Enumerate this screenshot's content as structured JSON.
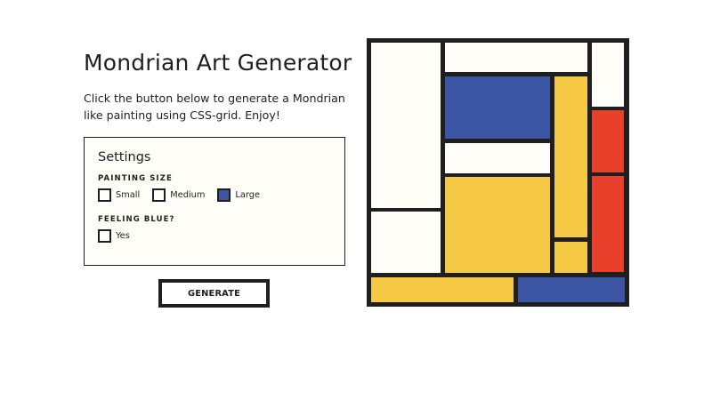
{
  "header": {
    "title": "Mondrian Art Generator",
    "description": "Click the button below to generate a Mondrian like painting using CSS-grid. Enjoy!"
  },
  "settings": {
    "title": "Settings",
    "painting_size": {
      "label": "PAINTING SIZE",
      "options": [
        {
          "label": "Small",
          "checked": false
        },
        {
          "label": "Medium",
          "checked": false
        },
        {
          "label": "Large",
          "checked": true
        }
      ]
    },
    "feeling_blue": {
      "label": "FEELING BLUE?",
      "options": [
        {
          "label": "Yes",
          "checked": false
        }
      ]
    }
  },
  "generate_button": {
    "label": "GENERATE"
  },
  "colors": {
    "white": "#fffdf8",
    "blue": "#3b55a3",
    "yellow": "#f6c944",
    "red": "#e8402a",
    "border": "#1f1f1f"
  }
}
